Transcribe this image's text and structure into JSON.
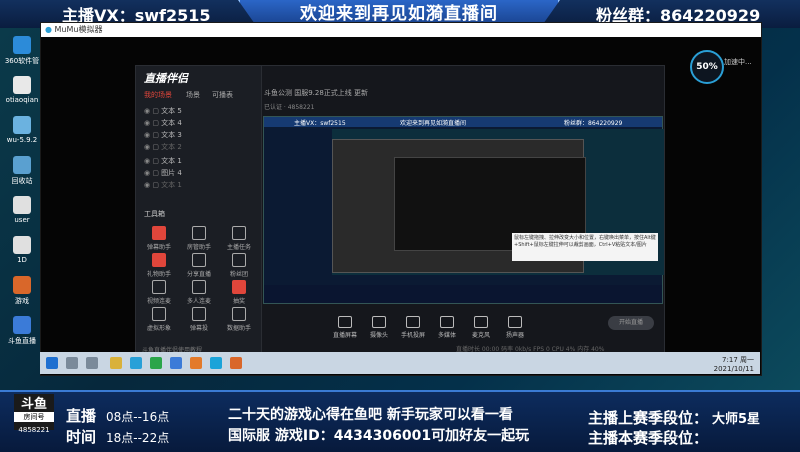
{
  "banner": {
    "left": "主播VX：swf2515",
    "center": "欢迎来到再见如漪直播间",
    "right": "粉丝群：864220929"
  },
  "desktop_icons": [
    {
      "label": "360软件管"
    },
    {
      "label": "otiaoqian"
    },
    {
      "label": "wu-5.9.2"
    },
    {
      "label": "回收站"
    },
    {
      "label": "user"
    },
    {
      "label": "1D"
    },
    {
      "label": "游戏"
    },
    {
      "label": "斗鱼直播"
    }
  ],
  "emulator": {
    "title": "MuMu模拟器",
    "gauge": "50%",
    "gauge_label": "加速中..."
  },
  "obs": {
    "logo": "直播伴侣",
    "tabs": [
      "我的场景",
      "场景",
      "可播表"
    ],
    "header": "斗鱼公测  国服9.28正式上线  更新",
    "subheader": "已认证  ·  4858221",
    "sources": [
      "文本 5",
      "文本 4",
      "文本 3",
      "文本 2",
      "文本 1",
      "图片 4",
      "文本 1"
    ],
    "tools_title": "工具箱",
    "tools": [
      {
        "label": "弹幕助手",
        "red": true
      },
      {
        "label": "房管助手",
        "red": false
      },
      {
        "label": "主播任务",
        "red": false
      },
      {
        "label": "礼物助手",
        "red": true
      },
      {
        "label": "分享直播",
        "red": false
      },
      {
        "label": "粉丝团",
        "red": false
      },
      {
        "label": "视频连麦",
        "red": false
      },
      {
        "label": "多人连麦",
        "red": false
      },
      {
        "label": "抽奖",
        "red": true
      },
      {
        "label": "虚拟形象",
        "red": false
      },
      {
        "label": "弹幕投",
        "red": false
      },
      {
        "label": "数据助手",
        "red": false
      }
    ],
    "side_footer": "斗鱼直播伴侣使用教程",
    "toolbar": [
      "直播屏幕",
      "摄像头",
      "手机投屏",
      "多媒体",
      "麦克风",
      "扬声器"
    ],
    "golive": "开始直播",
    "status": "直播时长 00:00  码率 0kb/s  FPS 0  CPU 4%  内存 40%"
  },
  "preview": {
    "top_left": "主播VX：swf2515",
    "top_center": "欢迎来到再见如漪直播间",
    "top_right": "粉丝群：864220929",
    "tooltip": "鼠标左键拖拽、拉伸改变大小和位置，右键唤出菜单，按住Alt键+Shift+鼠标左键拉伸可以裁剪画面，Ctrl+V粘贴文本/图片"
  },
  "taskbar": {
    "time": "7:17 周一",
    "date": "2021/10/11"
  },
  "bottom": {
    "logo_main": "斗鱼",
    "logo_sub": "房间号",
    "room_id": "4858221",
    "live_label": "直播",
    "live_time": "08点--16点",
    "time_label": "时间",
    "time_value": "18点--22点",
    "center_line1": "二十天的游戏心得在鱼吧  新手玩家可以看一看",
    "center_line2": "国际服  游戏ID：4434306001可加好友一起玩",
    "rank_label1": "主播上赛季段位：",
    "rank_value1": "大师5星",
    "rank_label2": "主播本赛季段位："
  },
  "colors": {
    "banner_bg": "#0a1d3f",
    "accent_blue": "#2b66c7",
    "obs_red": "#e0463b"
  }
}
